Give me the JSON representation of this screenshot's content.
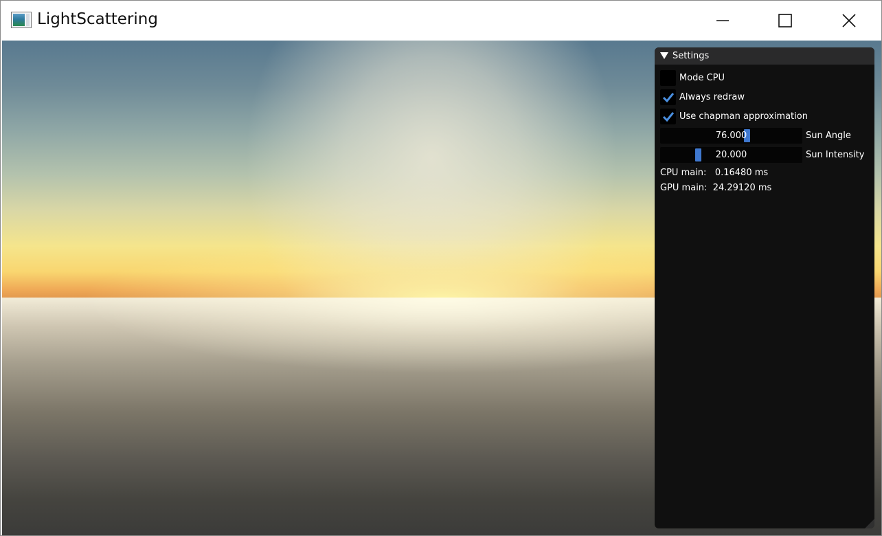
{
  "window": {
    "title": "LightScattering",
    "minimize_icon": "minimize-icon",
    "maximize_icon": "maximize-icon",
    "close_icon": "close-icon"
  },
  "settings": {
    "header": "Settings",
    "checkboxes": [
      {
        "label": "Mode CPU",
        "checked": false
      },
      {
        "label": "Always redraw",
        "checked": true
      },
      {
        "label": "Use chapman approximation",
        "checked": true
      }
    ],
    "sliders": [
      {
        "label": "Sun Angle",
        "value": "76.000",
        "fraction": 0.62
      },
      {
        "label": "Sun Intensity",
        "value": "20.000",
        "fraction": 0.25
      }
    ],
    "stats": [
      {
        "label": "CPU main:",
        "value": "0.16480 ms"
      },
      {
        "label": "GPU main:",
        "value": "24.29120 ms"
      }
    ]
  },
  "colors": {
    "accent": "#3f78cf",
    "check": "#4a8fe0",
    "panel_bg": "#101010",
    "header_bg": "#2a2a2b"
  }
}
